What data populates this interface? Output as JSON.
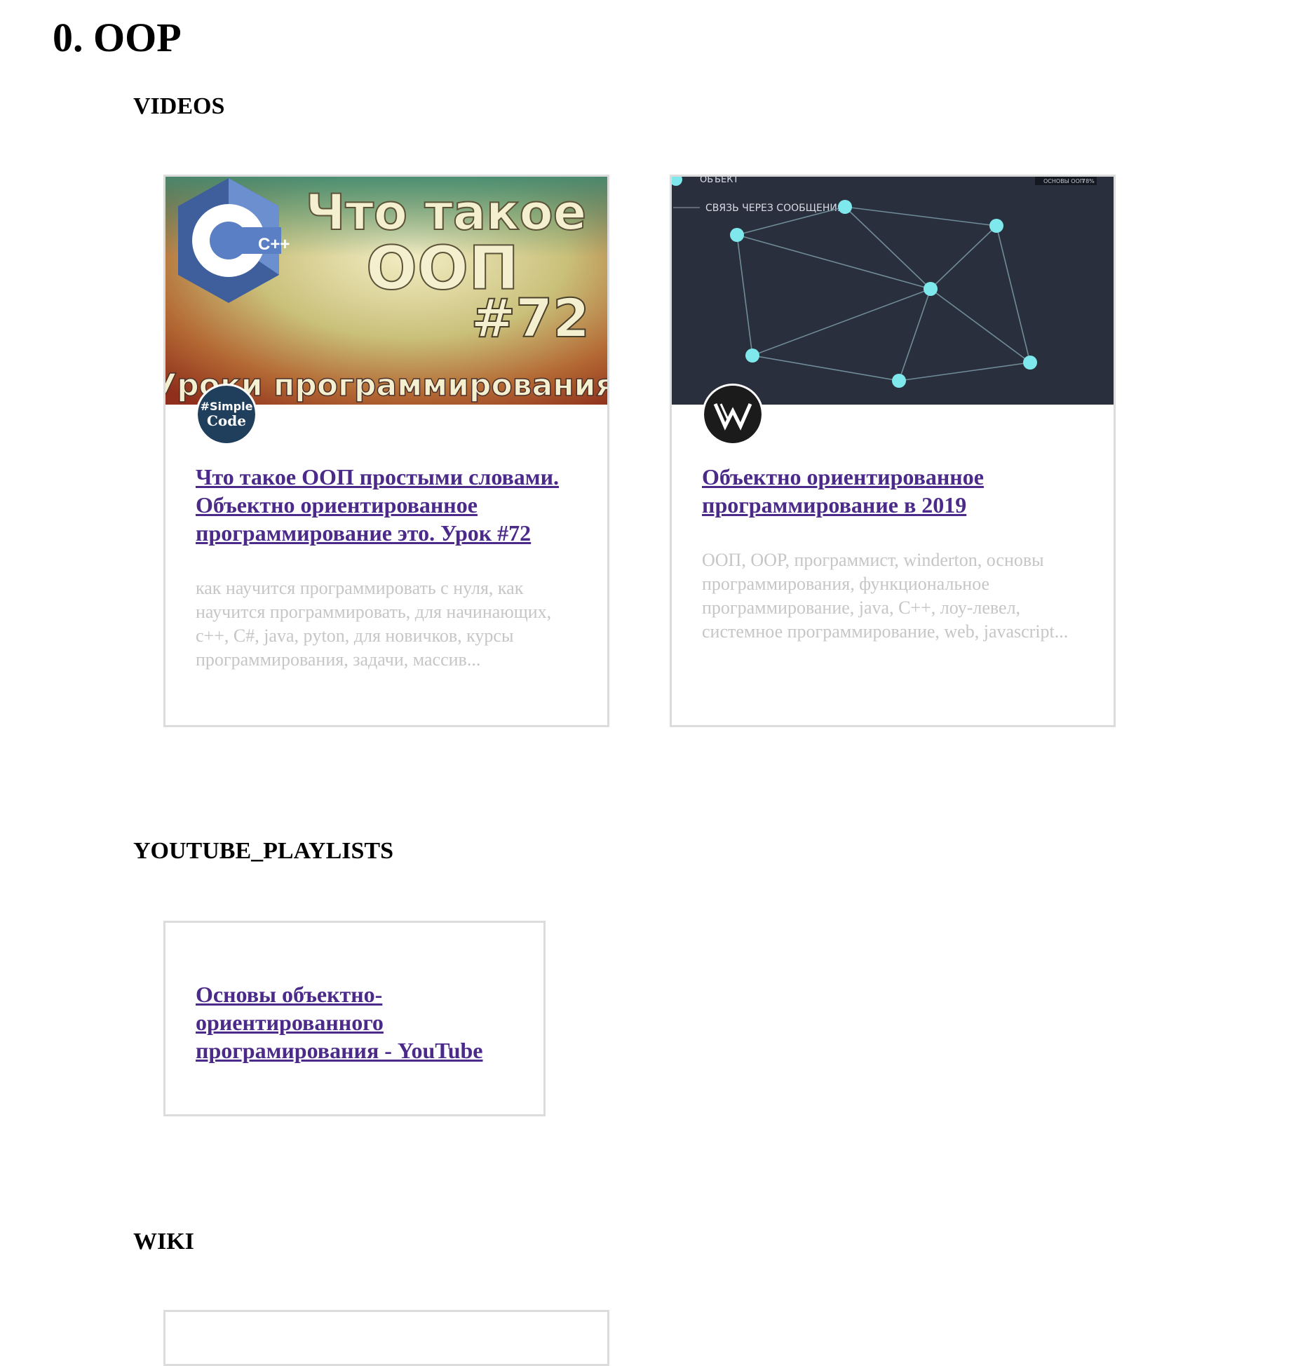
{
  "page": {
    "title": "0. OOP"
  },
  "sections": {
    "videos": "VIDEOS",
    "playlists": "YOUTUBE_PLAYLISTS",
    "wiki": "WIKI"
  },
  "videos": [
    {
      "title": "Что такое ООП простыми словами. Объектно ориентированное программирование это. Урок #72",
      "description": "как научится программировать с нуля, как научится программировать, для начинающих, с++, C#, java, pyton, для новичков, курсы программирования, задачи, массив...",
      "thumbnail": {
        "line1": "Что такое",
        "line2": "ООП",
        "line3": "#72",
        "line4": "Уроки программирования",
        "logo": "C++"
      },
      "channel": {
        "line1": "#Simple",
        "line2": "Code"
      }
    },
    {
      "title": "Объектно ориентированное программирование в 2019",
      "description": "ООП, OOP, программист, winderton, основы программирования, функциональное программирование, java, C++, лоу-левел, системное программирование, web, javascript...",
      "thumbnail": {
        "top_label": "ОБЪЕКТ",
        "subtitle": "СВЯЗЬ ЧЕРЕЗ СООБЩЕНИЯ",
        "corner_label": "ОСНОВЫ ООП",
        "corner_pct": "78%"
      },
      "channel": {
        "logo": "W"
      }
    }
  ],
  "playlists": [
    {
      "title": "Основы объектно-ориентированного програмирования - YouTube"
    }
  ],
  "colors": {
    "link": "#4b2a8a",
    "description": "#c6c6c6",
    "card_border": "#dcdcdc",
    "graph_bg": "#2a2f3d",
    "graph_node": "#7ee8ec"
  }
}
